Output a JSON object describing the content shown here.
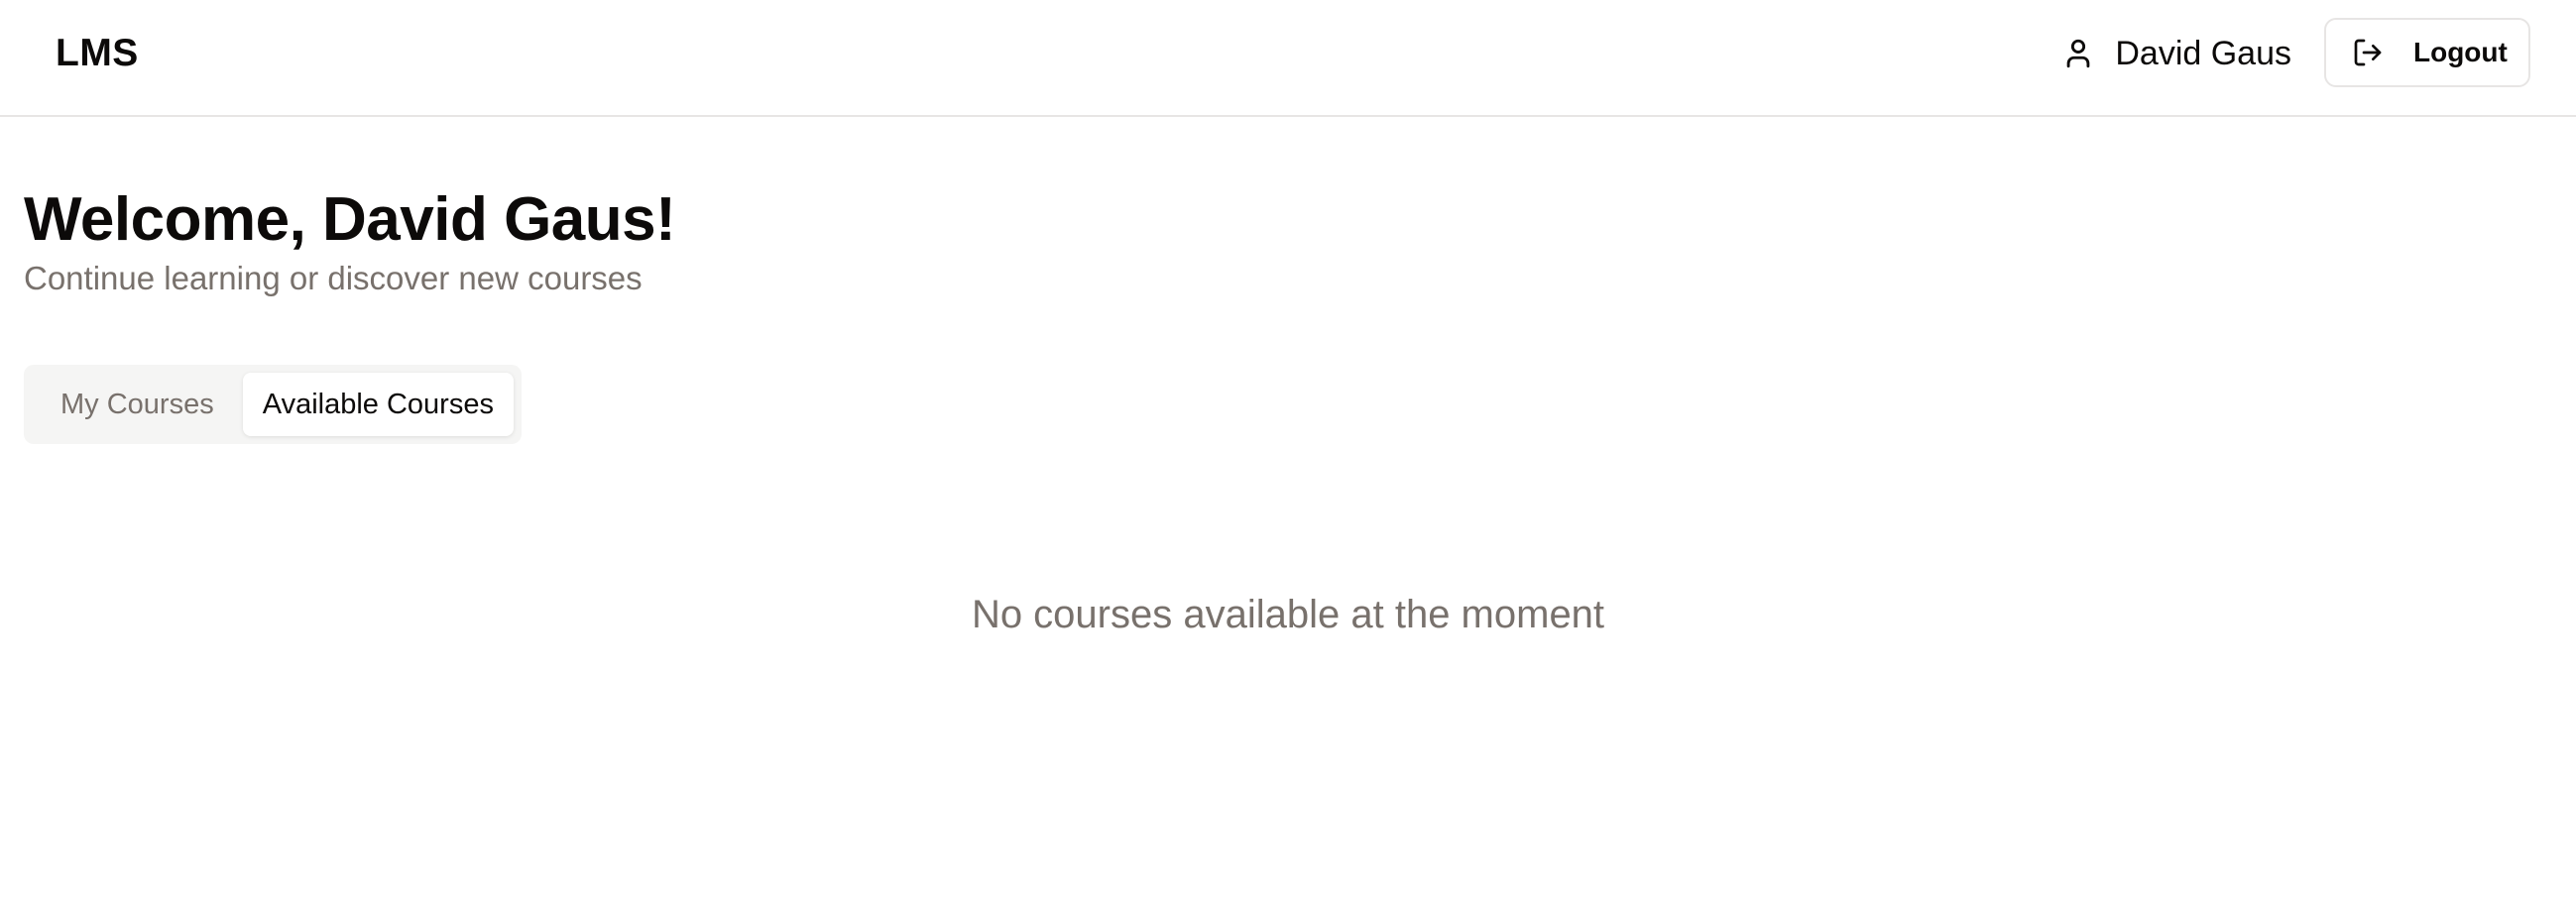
{
  "app": {
    "logo_text": "LMS"
  },
  "header": {
    "user_icon": "user-icon",
    "user_name": "David Gaus",
    "logout_icon": "logout-icon",
    "logout_label": "Logout"
  },
  "main": {
    "title": "Welcome, David Gaus!",
    "subtitle": "Continue learning or discover new courses",
    "tabs": [
      {
        "label": "My Courses",
        "active": false
      },
      {
        "label": "Available Courses",
        "active": true
      }
    ],
    "empty_message": "No courses available at the moment"
  },
  "colors": {
    "text": "#0c0a09",
    "muted": "#78716c",
    "border": "#e7e5e4",
    "tab_track": "#f5f5f4",
    "background": "#ffffff"
  }
}
